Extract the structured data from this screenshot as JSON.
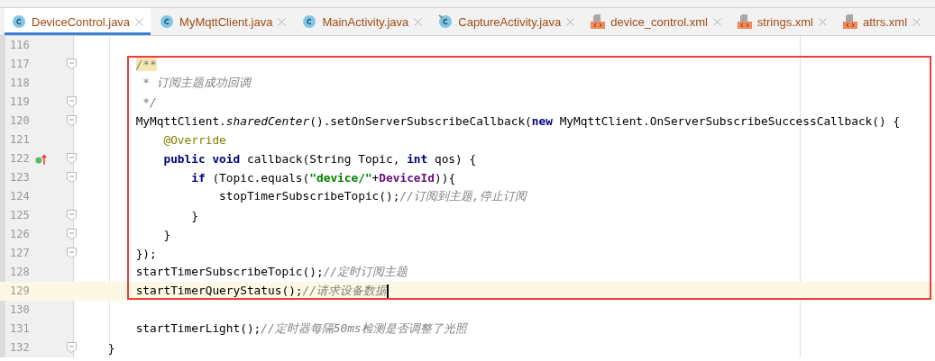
{
  "tabs": [
    {
      "label": "DeviceControl.java",
      "kind": "java",
      "selected": true
    },
    {
      "label": "MyMqttClient.java",
      "kind": "java",
      "selected": false
    },
    {
      "label": "MainActivity.java",
      "kind": "java",
      "selected": false
    },
    {
      "label": "CaptureActivity.java",
      "kind": "java-pinned",
      "selected": false
    },
    {
      "label": "device_control.xml",
      "kind": "xml",
      "selected": false
    },
    {
      "label": "strings.xml",
      "kind": "xml",
      "selected": false
    },
    {
      "label": "attrs.xml",
      "kind": "xml",
      "selected": false
    }
  ],
  "editor": {
    "blocks": [
      {
        "boxed": false,
        "lines": [
          {
            "number": "116",
            "fold": false,
            "current": false,
            "caret": false,
            "gutter_marker": false
          }
        ]
      },
      {
        "boxed": true,
        "lines": [
          {
            "number": "117",
            "fold": true,
            "current": false,
            "caret": false,
            "gutter_marker": false,
            "tokens": [
              {
                "text": "        /**",
                "kind": "comment-match"
              }
            ]
          },
          {
            "number": "118",
            "fold": false,
            "current": false,
            "caret": false,
            "gutter_marker": false,
            "tokens": [
              {
                "text": "         * 订阅主题成功回调",
                "kind": "comment"
              }
            ]
          },
          {
            "number": "119",
            "fold": true,
            "current": false,
            "caret": false,
            "gutter_marker": false,
            "tokens": [
              {
                "text": "         */",
                "kind": "comment"
              }
            ]
          },
          {
            "number": "120",
            "fold": true,
            "current": false,
            "caret": false,
            "gutter_marker": false,
            "tokens": [
              {
                "text": "        MyMqttClient.",
                "kind": "plain"
              },
              {
                "text": "sharedCenter",
                "kind": "static"
              },
              {
                "text": "().setOnServerSubscribeCallback(",
                "kind": "plain"
              },
              {
                "text": "new",
                "kind": "keyword"
              },
              {
                "text": " MyMqttClient.OnServerSubscribeSuccessCallback() {",
                "kind": "plain"
              }
            ]
          },
          {
            "number": "121",
            "fold": false,
            "current": false,
            "caret": false,
            "gutter_marker": false,
            "tokens": [
              {
                "text": "            @Override",
                "kind": "annotation"
              }
            ]
          },
          {
            "number": "122",
            "fold": true,
            "current": false,
            "caret": false,
            "gutter_marker": true,
            "tokens": [
              {
                "text": "            public",
                "kind": "keyword"
              },
              {
                "text": " void",
                "kind": "keyword"
              },
              {
                "text": " callback(String Topic, ",
                "kind": "plain"
              },
              {
                "text": "int",
                "kind": "keyword"
              },
              {
                "text": " qos) {",
                "kind": "plain"
              }
            ]
          },
          {
            "number": "123",
            "fold": true,
            "current": false,
            "caret": false,
            "gutter_marker": false,
            "tokens": [
              {
                "text": "                if",
                "kind": "keyword"
              },
              {
                "text": " (Topic.equals(",
                "kind": "plain"
              },
              {
                "text": "\"device/\"",
                "kind": "string"
              },
              {
                "text": "+",
                "kind": "plain"
              },
              {
                "text": "DeviceId",
                "kind": "field"
              },
              {
                "text": ")){",
                "kind": "plain"
              }
            ]
          },
          {
            "number": "124",
            "fold": false,
            "current": false,
            "caret": false,
            "gutter_marker": false,
            "tokens": [
              {
                "text": "                    stopTimerSubscribeTopic();",
                "kind": "plain"
              },
              {
                "text": "//订阅到主题,停止订阅",
                "kind": "comment"
              }
            ]
          },
          {
            "number": "125",
            "fold": true,
            "current": false,
            "caret": false,
            "gutter_marker": false,
            "tokens": [
              {
                "text": "                }",
                "kind": "plain"
              }
            ]
          },
          {
            "number": "126",
            "fold": true,
            "current": false,
            "caret": false,
            "gutter_marker": false,
            "tokens": [
              {
                "text": "            }",
                "kind": "plain"
              }
            ]
          },
          {
            "number": "127",
            "fold": true,
            "current": false,
            "caret": false,
            "gutter_marker": false,
            "tokens": [
              {
                "text": "        });",
                "kind": "plain"
              }
            ]
          },
          {
            "number": "128",
            "fold": false,
            "current": false,
            "caret": false,
            "gutter_marker": false,
            "tokens": [
              {
                "text": "        startTimerSubscribeTopic();",
                "kind": "plain"
              },
              {
                "text": "//定时订阅主题",
                "kind": "comment"
              }
            ]
          },
          {
            "number": "129",
            "fold": false,
            "current": true,
            "caret": true,
            "gutter_marker": false,
            "tokens": [
              {
                "text": "        startTimerQueryStatus();",
                "kind": "plain"
              },
              {
                "text": "//请求设备数据",
                "kind": "comment"
              }
            ]
          }
        ]
      },
      {
        "boxed": false,
        "lines": [
          {
            "number": "130",
            "fold": false,
            "current": false,
            "caret": false,
            "gutter_marker": false
          },
          {
            "number": "131",
            "fold": false,
            "current": false,
            "caret": false,
            "gutter_marker": false,
            "tokens": [
              {
                "text": "        startTimerLight();",
                "kind": "plain"
              },
              {
                "text": "//定时器每隔50ms检测是否调整了光照",
                "kind": "comment"
              }
            ]
          },
          {
            "number": "132",
            "fold": true,
            "current": false,
            "caret": false,
            "gutter_marker": false,
            "tokens": [
              {
                "text": "    }",
                "kind": "plain"
              }
            ]
          }
        ]
      }
    ]
  }
}
